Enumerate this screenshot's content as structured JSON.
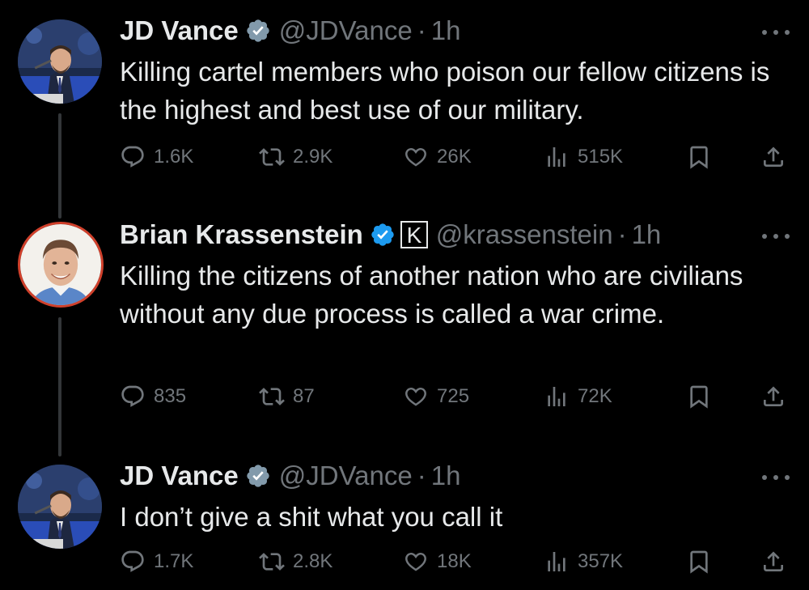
{
  "tweets": [
    {
      "name": "JD Vance",
      "handle": "@JDVance",
      "separator": "·",
      "time": "1h",
      "text": "Killing cartel members who poison our fellow citizens is the highest and best use of our military.",
      "replies": "1.6K",
      "retweets": "2.9K",
      "likes": "26K",
      "views": "515K",
      "badge_color": "#829aab",
      "icons": [
        "verified-badge-icon",
        "reply-icon",
        "retweet-icon",
        "like-icon",
        "views-icon",
        "bookmark-icon",
        "share-icon",
        "more-icon"
      ]
    },
    {
      "name": "Brian Krassenstein",
      "handle": "@krassenstein",
      "separator": "·",
      "time": "1h",
      "text": "Killing the citizens of another nation who are civilians without any due process is called a war crime.",
      "replies": "835",
      "retweets": "87",
      "likes": "725",
      "views": "72K",
      "badge_color": "#1d9bf0",
      "affiliate_badge_letter": "K",
      "icons": [
        "verified-badge-icon",
        "affiliate-k-icon",
        "reply-icon",
        "retweet-icon",
        "like-icon",
        "views-icon",
        "bookmark-icon",
        "share-icon",
        "more-icon"
      ]
    },
    {
      "name": "JD Vance",
      "handle": "@JDVance",
      "separator": "·",
      "time": "1h",
      "text": "I don’t give a shit what you call it",
      "replies": "1.7K",
      "retweets": "2.8K",
      "likes": "18K",
      "views": "357K",
      "badge_color": "#829aab",
      "icons": [
        "verified-badge-icon",
        "reply-icon",
        "retweet-icon",
        "like-icon",
        "views-icon",
        "bookmark-icon",
        "share-icon",
        "more-icon"
      ]
    }
  ],
  "colors": {
    "background": "#000000",
    "text": "#e7e9ea",
    "secondary": "#71767b",
    "thread_line": "#333639",
    "avatar_ring": "#d0402b"
  }
}
